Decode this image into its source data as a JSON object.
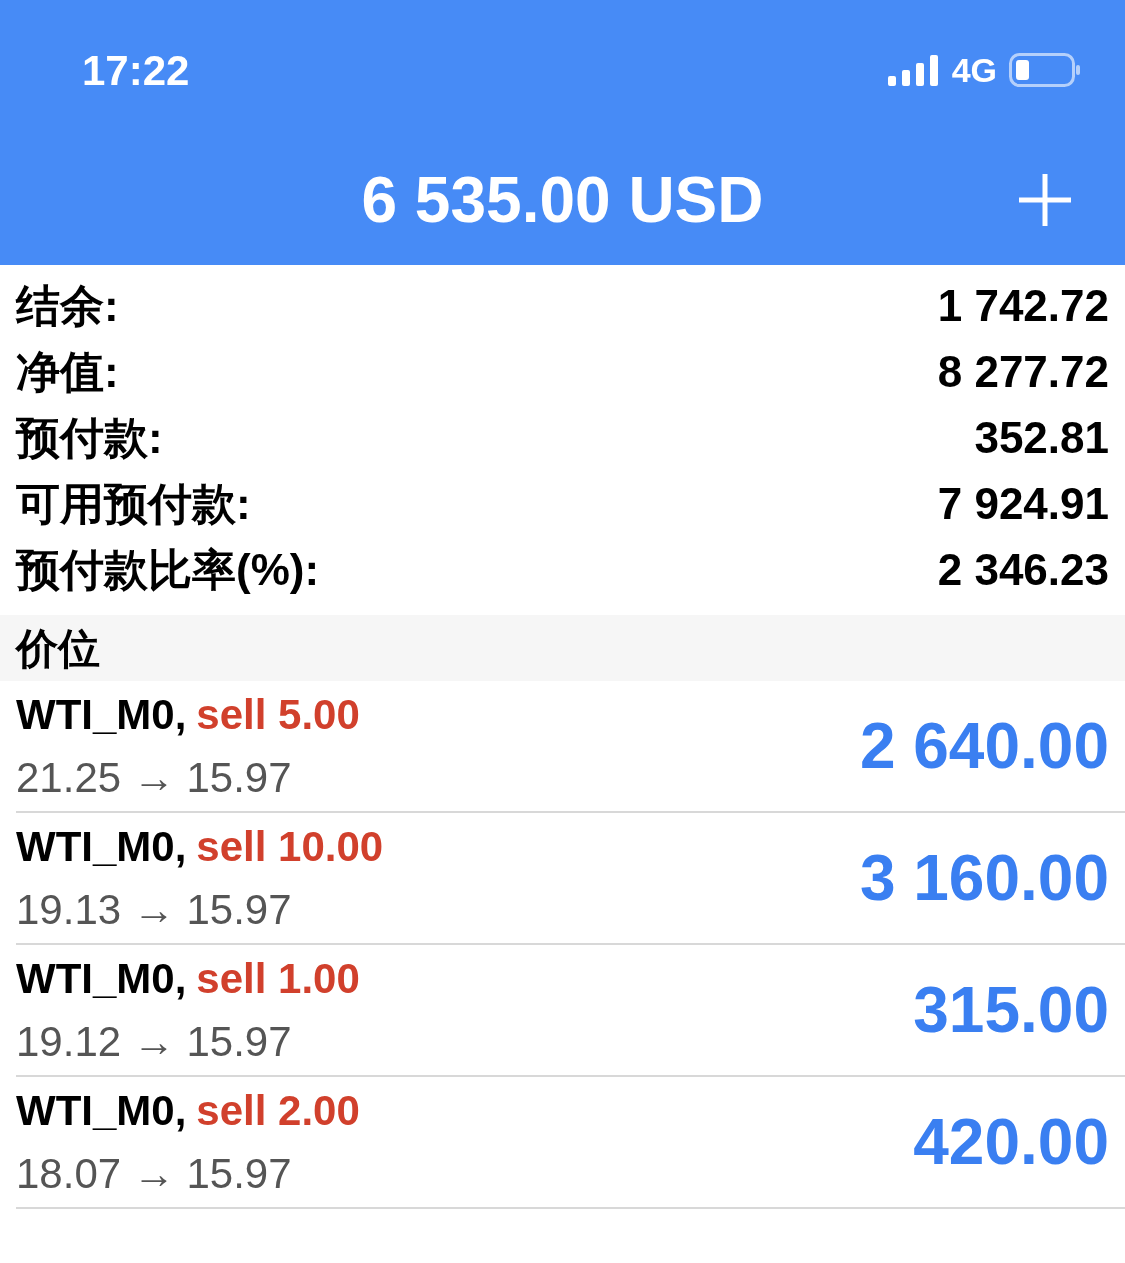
{
  "status_bar": {
    "time": "17:22",
    "network": "4G"
  },
  "header": {
    "title": "6 535.00 USD"
  },
  "summary": [
    {
      "label": "结余:",
      "value": "1 742.72"
    },
    {
      "label": "净值:",
      "value": "8 277.72"
    },
    {
      "label": "预付款:",
      "value": "352.81"
    },
    {
      "label": "可用预付款:",
      "value": "7 924.91"
    },
    {
      "label": "预付款比率(%):",
      "value": "2 346.23"
    }
  ],
  "section": {
    "title": "价位"
  },
  "positions": [
    {
      "symbol": "WTI_M0,",
      "order": "sell 5.00",
      "prices": "21.25 → 15.97",
      "profit": "2 640.00"
    },
    {
      "symbol": "WTI_M0,",
      "order": "sell 10.00",
      "prices": "19.13 → 15.97",
      "profit": "3 160.00"
    },
    {
      "symbol": "WTI_M0,",
      "order": "sell 1.00",
      "prices": "19.12 → 15.97",
      "profit": "315.00"
    },
    {
      "symbol": "WTI_M0,",
      "order": "sell 2.00",
      "prices": "18.07 → 15.97",
      "profit": "420.00"
    }
  ]
}
